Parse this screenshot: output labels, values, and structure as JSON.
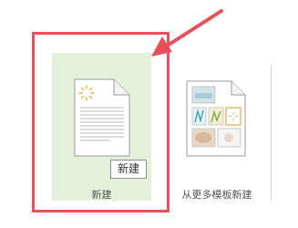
{
  "tiles": [
    {
      "label": "新建",
      "tooltip": "新建",
      "selected": true
    },
    {
      "label": "从更多模板新建"
    }
  ],
  "icons": {
    "new_document": "blank-document-icon",
    "templates": "template-gallery-icon",
    "annotation": "red-arrow-icon"
  },
  "colors": {
    "selected_tile_bg": "#e5f0da",
    "annotation_red": "#e8515a",
    "loading_spinner": "#f2b23a"
  }
}
